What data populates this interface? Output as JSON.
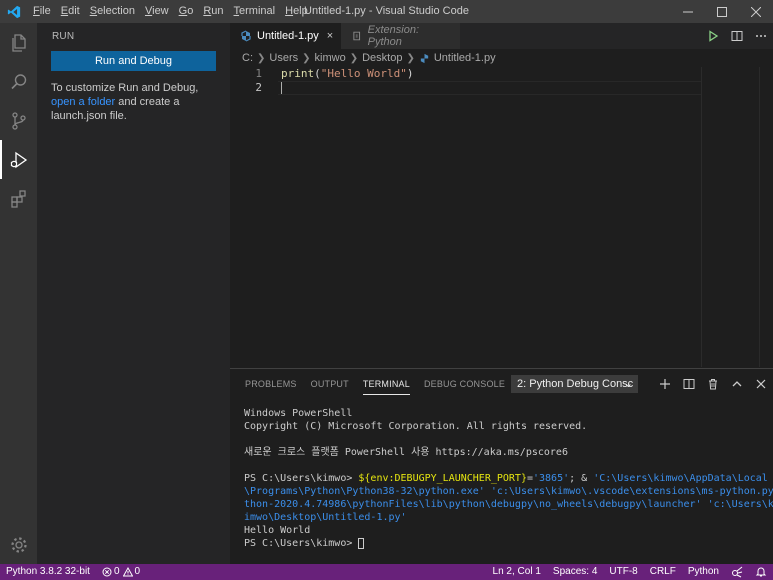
{
  "window": {
    "title": "Untitled-1.py - Visual Studio Code",
    "menu": [
      "File",
      "Edit",
      "Selection",
      "View",
      "Go",
      "Run",
      "Terminal",
      "Help"
    ]
  },
  "sidebar": {
    "title": "RUN",
    "run_debug_label": "Run and Debug",
    "text_before": "To customize Run and Debug, ",
    "link_text": "open a folder",
    "text_after": " and create a launch.json file."
  },
  "editor": {
    "tabs": [
      {
        "label": "Untitled-1.py",
        "close": "×"
      },
      {
        "label": "Extension: Python"
      }
    ],
    "breadcrumb": [
      "C:",
      "Users",
      "kimwo",
      "Desktop",
      "Untitled-1.py"
    ],
    "lines": [
      {
        "number": "1",
        "fn": "print",
        "open": "(",
        "str": "\"Hello World\"",
        "close": ")"
      },
      {
        "number": "2"
      }
    ]
  },
  "panel": {
    "tabs": [
      "PROBLEMS",
      "OUTPUT",
      "TERMINAL",
      "DEBUG CONSOLE"
    ],
    "terminal_select": "2: Python Debug Consc",
    "terminal": {
      "line1": "Windows PowerShell",
      "line2": "Copyright (C) Microsoft Corporation. All rights reserved.",
      "line3": "새로운 크로스 플랫폼 PowerShell 사용 https://aka.ms/pscore6",
      "prompt": "PS C:\\Users\\kimwo> ",
      "cmd_var": "${env:DEBUGPY_LAUNCHER_PORT}",
      "cmd_eq": "=",
      "cmd_port": "'3865'",
      "cmd_amp": "; & ",
      "cmd_path1": "'C:\\Users\\kimwo\\AppData\\Local",
      "cmd_path2": "\\Programs\\Python\\Python38-32\\python.exe' 'c:\\Users\\kimwo\\.vscode\\extensions\\ms-python.py",
      "cmd_path3": "thon-2020.4.74986\\pythonFiles\\lib\\python\\debugpy\\no_wheels\\debugpy\\launcher' 'c:\\Users\\k",
      "cmd_path4": "imwo\\Desktop\\Untitled-1.py'",
      "output": "Hello World",
      "prompt2": "PS C:\\Users\\kimwo> "
    }
  },
  "statusbar": {
    "python": "Python 3.8.2 32-bit",
    "errors": "0",
    "warnings": "0",
    "position": "Ln 2, Col 1",
    "spaces": "Spaces: 4",
    "encoding": "UTF-8",
    "eol": "CRLF",
    "language": "Python"
  },
  "colors": {
    "statusbar": "#68217a",
    "button": "#0e639c",
    "accent": "#007acc"
  }
}
